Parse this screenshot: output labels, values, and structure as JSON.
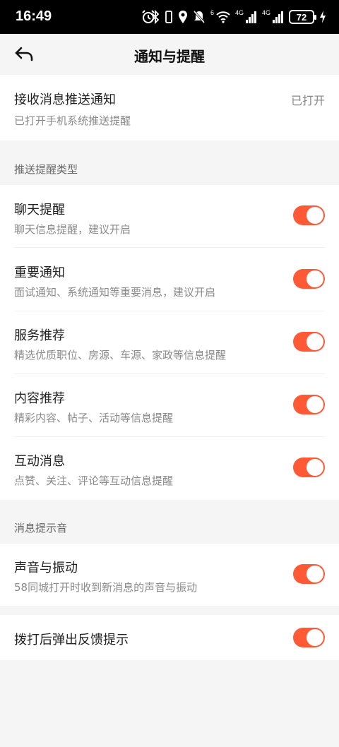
{
  "status_bar": {
    "time": "16:49",
    "battery": "72",
    "net1": "4G",
    "net2": "4G",
    "wifi_label": "6"
  },
  "header": {
    "title": "通知与提醒"
  },
  "push": {
    "title": "接收消息推送通知",
    "status": "已打开",
    "subtitle": "已打开手机系统推送提醒"
  },
  "sections": {
    "types": "推送提醒类型",
    "sound": "消息提示音"
  },
  "types": [
    {
      "title": "聊天提醒",
      "subtitle": "聊天信息提醒，建议开启",
      "on": true
    },
    {
      "title": "重要通知",
      "subtitle": "面试通知、系统通知等重要消息，建议开启",
      "on": true
    },
    {
      "title": "服务推荐",
      "subtitle": "精选优质职位、房源、车源、家政等信息提醒",
      "on": true
    },
    {
      "title": "内容推荐",
      "subtitle": "精彩内容、帖子、活动等信息提醒",
      "on": true
    },
    {
      "title": "互动消息",
      "subtitle": "点赞、关注、评论等互动信息提醒",
      "on": true
    }
  ],
  "sound": {
    "title": "声音与振动",
    "subtitle": "58同城打开时收到新消息的声音与振动",
    "on": true
  },
  "dial": {
    "title": "拨打后弹出反馈提示",
    "on": true
  },
  "colors": {
    "accent": "#ff5a35",
    "background": "#f5f5f5"
  }
}
